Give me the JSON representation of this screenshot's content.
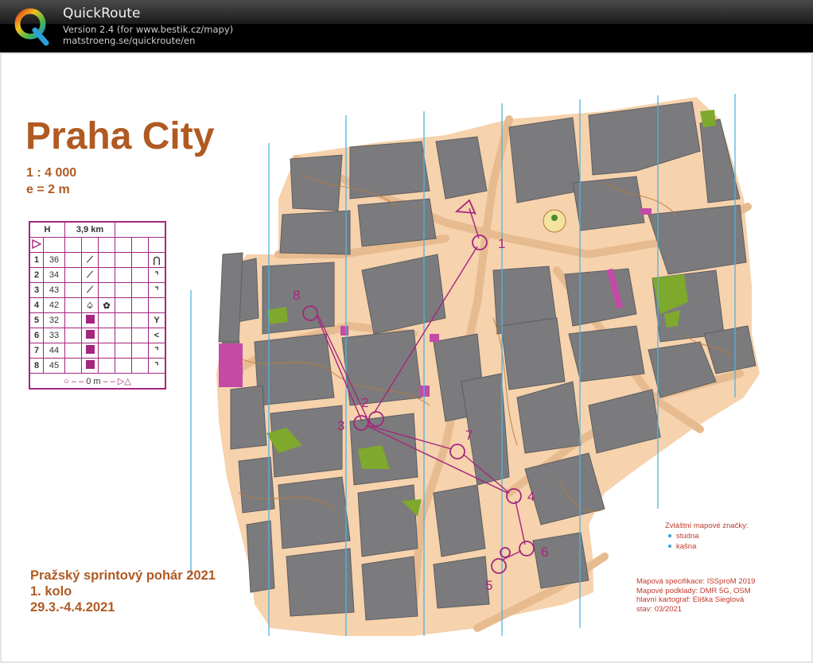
{
  "app": {
    "title": "QuickRoute",
    "version_line": "Version 2.4  (for www.bestik.cz/mapy)",
    "url": "matstroeng.se/quickroute/en"
  },
  "map": {
    "title": "Praha City",
    "scale": "1 : 4 000",
    "equidistance": "e = 2 m",
    "event_name": "Pražský sprintový pohár 2021",
    "event_round": "1. kolo",
    "event_dates": "29.3.-4.4.2021",
    "special_symbols_title": "Zvláštní mapové značky:",
    "special_symbols": [
      "studna",
      "kašna"
    ],
    "credits": [
      "Mapová specifikace: ISSproM 2019",
      "Mapové podklady: DMR 5G, OSM",
      "hlavní kartograf: Eliška Sieglová",
      "stav: 03/2021"
    ]
  },
  "control_descriptions": {
    "header_class": "H",
    "header_length": "3,9 km",
    "rows": [
      {
        "n": "1",
        "code": "36"
      },
      {
        "n": "2",
        "code": "34"
      },
      {
        "n": "3",
        "code": "43"
      },
      {
        "n": "4",
        "code": "42"
      },
      {
        "n": "5",
        "code": "32"
      },
      {
        "n": "6",
        "code": "33"
      },
      {
        "n": "7",
        "code": "44"
      },
      {
        "n": "8",
        "code": "45"
      }
    ],
    "finish_text": "0 m"
  },
  "controls": [
    {
      "label": "1"
    },
    {
      "label": "2"
    },
    {
      "label": "3"
    },
    {
      "label": "4"
    },
    {
      "label": "5"
    },
    {
      "label": "6"
    },
    {
      "label": "7"
    },
    {
      "label": "8"
    }
  ],
  "colors": {
    "building": "#7b7b7d",
    "paved": "#f6d2ad",
    "road": "#e7bb90",
    "course": "#a4267e",
    "contour": "#b87a3c",
    "north_lines": "#4fb3e0",
    "green": "#7ea92c",
    "title": "#b05a22"
  }
}
